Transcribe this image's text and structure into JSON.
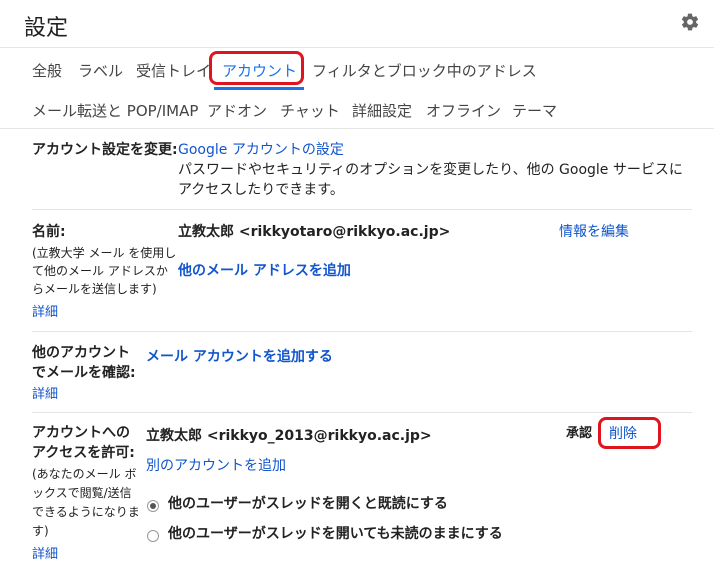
{
  "page": {
    "title": "設定"
  },
  "tabs_row1": [
    {
      "label": "全般"
    },
    {
      "label": "ラベル"
    },
    {
      "label": "受信トレイ"
    },
    {
      "label": "アカウント"
    },
    {
      "label": "フィルタとブロック中のアドレス"
    }
  ],
  "tabs_row2": [
    {
      "label": "メール転送と POP/IMAP"
    },
    {
      "label": "アドオン"
    },
    {
      "label": "チャット"
    },
    {
      "label": "詳細設定"
    },
    {
      "label": "オフライン"
    },
    {
      "label": "テーマ"
    }
  ],
  "account_change": {
    "label": "アカウント設定を変更:",
    "link": "Google アカウントの設定",
    "desc_line1": "パスワードやセキュリティのオプションを変更したり、他の Google サービスに",
    "desc_line2": "アクセスしたりできます。"
  },
  "name_section": {
    "label": "名前:",
    "sub_lines": [
      "(立教大学 メール を使用し",
      "て他のメール アドレスか",
      "らメールを送信します)"
    ],
    "details": "詳細",
    "value": "立教太郎 <rikkyotaro@rikkyo.ac.jp>",
    "edit_link": "情報を編集",
    "add_link": "他のメール アドレスを追加"
  },
  "other_accounts": {
    "label_lines": [
      "他のアカウント",
      "でメールを確認:"
    ],
    "details": "詳細",
    "add_link": "メール アカウントを追加する"
  },
  "grant_access": {
    "label_lines": [
      "アカウントへの",
      "アクセスを許可:"
    ],
    "sub_lines": [
      "(あなたのメール ボ",
      "ックスで閲覧/送信",
      "できるようになりま",
      "す)"
    ],
    "details": "詳細",
    "value": "立教太郎 <rikkyo_2013@rikkyo.ac.jp>",
    "status": "承認",
    "delete_link": "削除",
    "add_link": "別のアカウントを追加",
    "radio1": "他のユーザーがスレッドを開くと既読にする",
    "radio2": "他のユーザーがスレッドを開いても未読のままにする",
    "radio_selected": "radio1"
  },
  "colors": {
    "link": "#1155cc",
    "accent": "#1a73e8",
    "highlight": "#e0141e"
  }
}
